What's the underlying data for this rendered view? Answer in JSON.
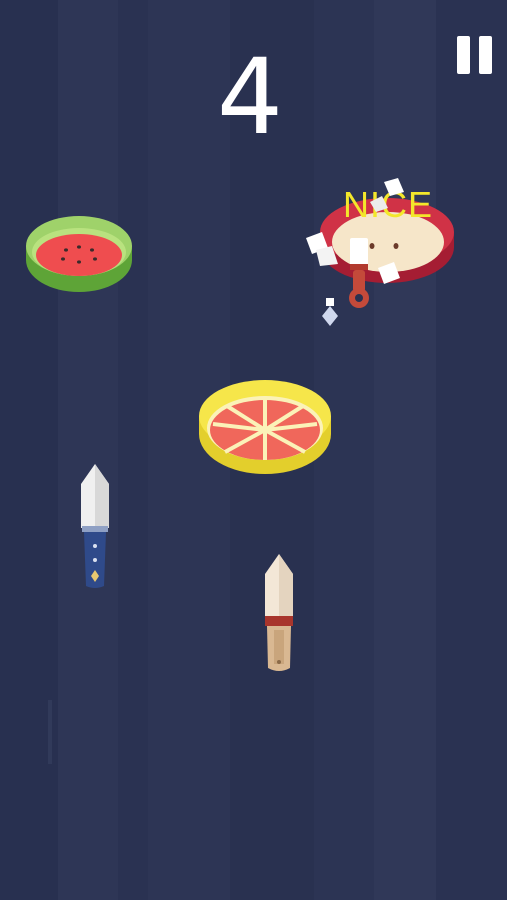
{
  "score": "4",
  "feedback_text": "NICE",
  "pause_icon": "pause-icon",
  "fruits": [
    {
      "name": "watermelon",
      "colors": {
        "rind": "#7bc24a",
        "flesh": "#ef4d4f",
        "seed": "#3a2a2a"
      }
    },
    {
      "name": "apple",
      "colors": {
        "skin": "#c8263d",
        "flesh": "#f6e6c9"
      }
    },
    {
      "name": "grapefruit",
      "colors": {
        "peel": "#f3e33d",
        "flesh": "#f0675b"
      }
    }
  ],
  "knives": [
    {
      "name": "player-knife-blue",
      "colors": {
        "blade": "#f0f0f0",
        "handle": "#2f4a8a"
      }
    },
    {
      "name": "player-knife-wood",
      "colors": {
        "blade": "#f3e7d7",
        "handle": "#d9b892",
        "band": "#a8352c"
      }
    },
    {
      "name": "stuck-knife",
      "colors": {
        "handle": "#c44a3a"
      }
    }
  ],
  "colors": {
    "background": "#2a3150",
    "score_text": "#ffffff",
    "nice_text": "#f3e72b"
  }
}
